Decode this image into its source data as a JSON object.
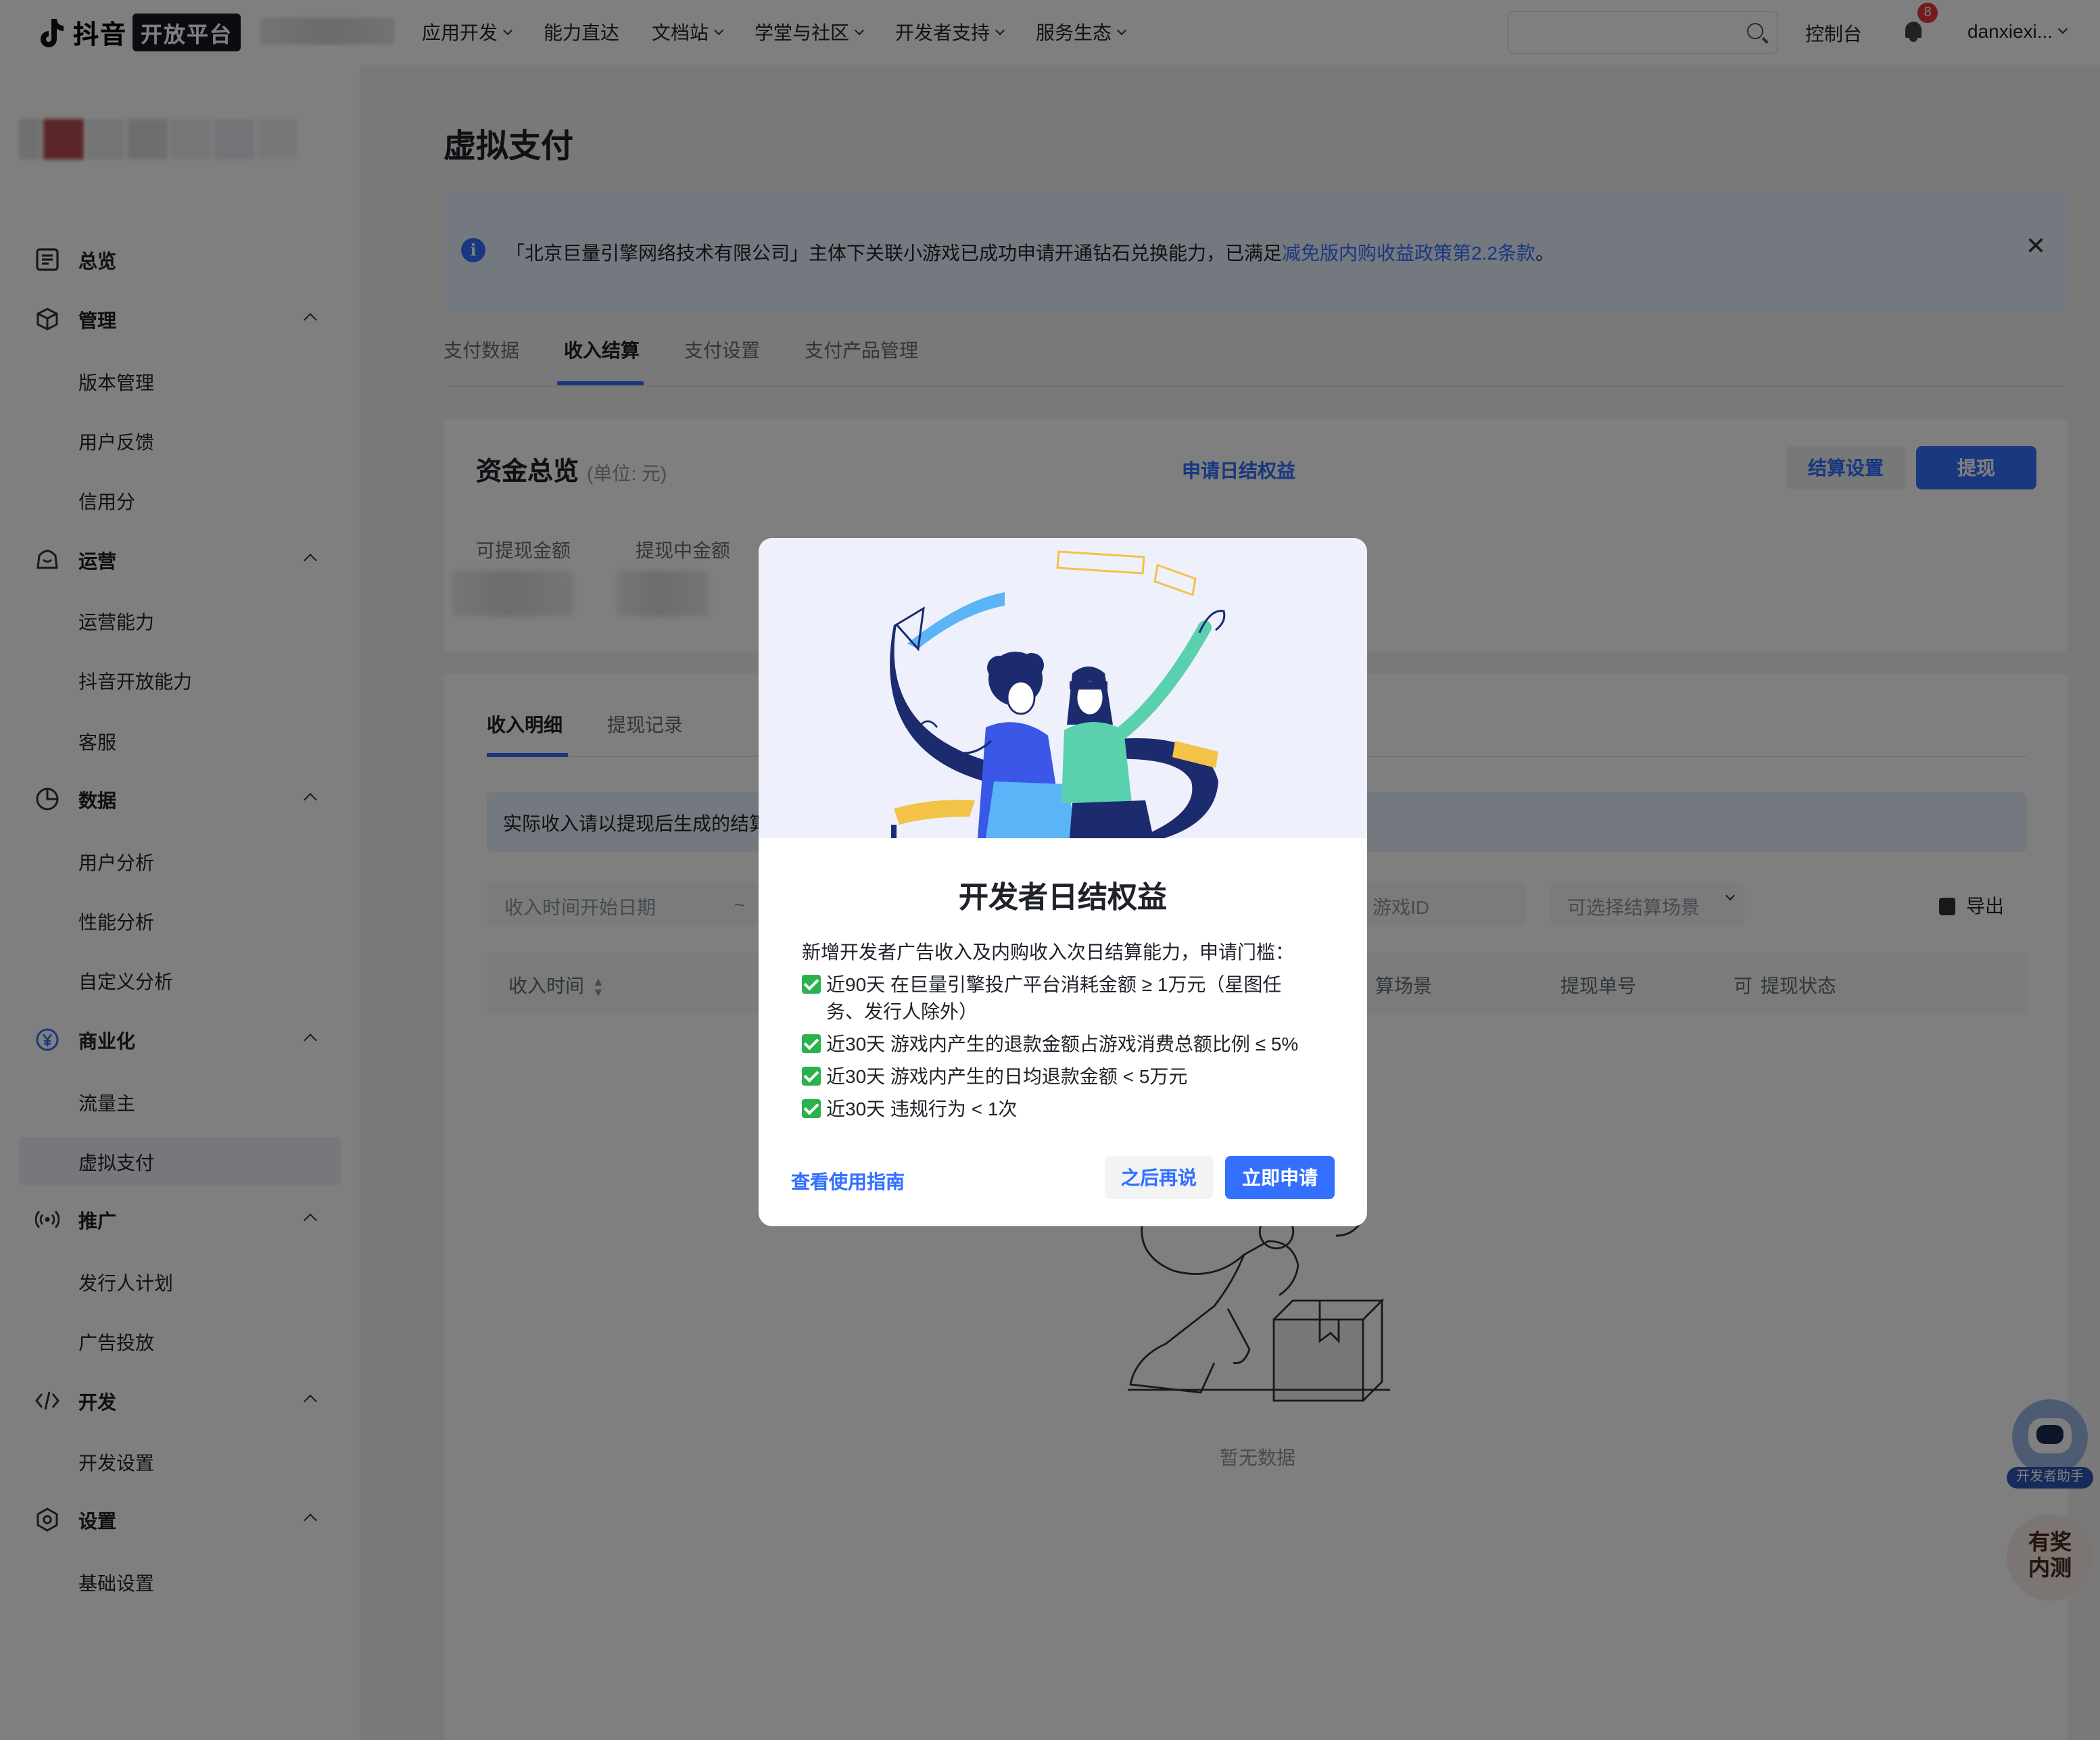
{
  "header": {
    "logo_text": "抖音",
    "logo_badge": "开放平台",
    "nav": [
      {
        "label": "应用开发",
        "dropdown": true
      },
      {
        "label": "能力直达",
        "dropdown": false
      },
      {
        "label": "文档站",
        "dropdown": true
      },
      {
        "label": "学堂与社区",
        "dropdown": true
      },
      {
        "label": "开发者支持",
        "dropdown": true
      },
      {
        "label": "服务生态",
        "dropdown": true
      }
    ],
    "search_placeholder": "",
    "console": "控制台",
    "notification_count": "8",
    "username": "danxiexi..."
  },
  "sidebar": {
    "groups": [
      {
        "label": "总览",
        "icon": "overview-icon",
        "items": []
      },
      {
        "label": "管理",
        "icon": "cube-icon",
        "items": [
          "版本管理",
          "用户反馈",
          "信用分"
        ]
      },
      {
        "label": "运营",
        "icon": "bag-icon",
        "items": [
          "运营能力",
          "抖音开放能力",
          "客服"
        ]
      },
      {
        "label": "数据",
        "icon": "pie-chart-icon",
        "items": [
          "用户分析",
          "性能分析",
          "自定义分析"
        ]
      },
      {
        "label": "商业化",
        "icon": "yuan-icon",
        "items": [
          "流量主",
          "虚拟支付"
        ]
      },
      {
        "label": "推广",
        "icon": "broadcast-icon",
        "items": [
          "发行人计划",
          "广告投放"
        ]
      },
      {
        "label": "开发",
        "icon": "code-icon",
        "items": [
          "开发设置"
        ]
      },
      {
        "label": "设置",
        "icon": "settings-icon",
        "items": [
          "基础设置"
        ]
      }
    ],
    "active_item": "虚拟支付"
  },
  "page": {
    "title": "虚拟支付",
    "notice": {
      "text": "「北京巨量引擎网络技术有限公司」主体下关联小游戏已成功申请开通钻石兑换能力，已满足",
      "link": "减免版内购收益政策第2.2条款",
      "suffix": "。"
    },
    "tabs": [
      "支付数据",
      "收入结算",
      "支付设置",
      "支付产品管理"
    ],
    "active_tab": "收入结算",
    "overview": {
      "title": "资金总览",
      "unit": "(单位: 元)",
      "daily_link": "申请日结权益",
      "settle_button": "结算设置",
      "withdraw_button": "提现",
      "withdrawable_label": "可提现金额",
      "withdrawing_label": "提现中金额"
    },
    "detail": {
      "subtabs": [
        "收入明细",
        "提现记录"
      ],
      "active_subtab": "收入明细",
      "tip": "实际收入请以提现后生成的结算",
      "filters": {
        "start_date": "收入时间开始日期",
        "range_sep": "~",
        "game_id": "游戏ID",
        "scene": "可选择结算场景"
      },
      "export": "导出",
      "columns": [
        "收入时间",
        "算场景",
        "提现单号",
        "可",
        "提现状态"
      ],
      "empty": "暂无数据"
    }
  },
  "modal": {
    "title": "开发者日结权益",
    "intro": "新增开发者广告收入及内购收入次日结算能力，申请门槛：",
    "requirements": [
      "近90天 在巨量引擎投广平台消耗金额 ≥ 1万元（星图任务、发行人除外）",
      "近30天 游戏内产生的退款金额占游戏消费总额比例 ≤ 5%",
      "近30天 游戏内产生的日均退款金额 < 5万元",
      "近30天 违规行为 < 1次"
    ],
    "guide_link": "查看使用指南",
    "later_button": "之后再说",
    "apply_button": "立即申请"
  },
  "floating": {
    "assistant_label": "开发者助手",
    "prize_line1": "有奖",
    "prize_line2": "内测"
  },
  "colors": {
    "primary": "#3370ff",
    "notice_bg": "#e8f0fe",
    "badge": "#e4393c"
  }
}
